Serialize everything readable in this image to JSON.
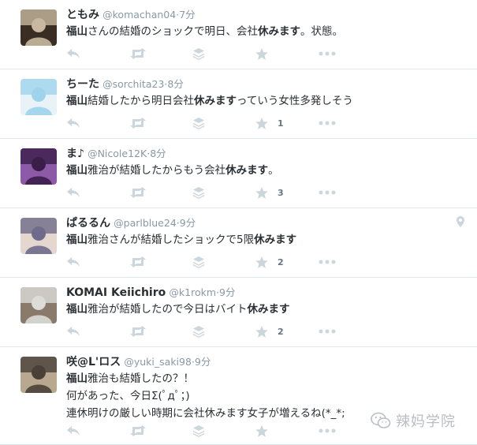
{
  "tweets": [
    {
      "name": "ともみ",
      "handle": "@komachan04",
      "dot": "·",
      "time": "7分",
      "lines": [
        [
          "福山",
          "さんの結婚のショックで明日、会社",
          "休みます",
          "。状態。"
        ]
      ],
      "favorites": "",
      "avatar_colors": [
        "#c9b9a0",
        "#3a2e24"
      ]
    },
    {
      "name": "ちーた",
      "handle": "@sorchita23",
      "dot": "·",
      "time": "8分",
      "lines": [
        [
          "福山",
          "結婚したから明日会社",
          "休みます",
          "っていう女性多発しそう"
        ]
      ],
      "favorites": "1",
      "avatar_colors": [
        "#9fd3ec",
        "#e9f3f7"
      ]
    },
    {
      "name": "ま♪",
      "handle": "@Nicole12K",
      "dot": "·",
      "time": "8分",
      "lines": [
        [
          "福山",
          "雅治が結婚したからもう会社",
          "休みます",
          "。"
        ]
      ],
      "favorites": "3",
      "avatar_colors": [
        "#3b1d4a",
        "#8c5aa6"
      ]
    },
    {
      "name": "ぱるるん",
      "handle": "@parlblue24",
      "dot": "·",
      "time": "9分",
      "lines": [
        [
          "福山",
          "雅治さんが結婚したショックで5限",
          "休みます",
          ""
        ]
      ],
      "favorites": "2",
      "avatar_colors": [
        "#6f6b8a",
        "#e3d7cf"
      ],
      "location": true
    },
    {
      "name": "KOMAI Keiichiro",
      "handle": "@k1rokm",
      "dot": "·",
      "time": "9分",
      "lines": [
        [
          "福山",
          "雅治が結婚したので今日はバイト",
          "休みます",
          ""
        ]
      ],
      "favorites": "2",
      "avatar_colors": [
        "#dcdcd8",
        "#8a7a6c"
      ]
    },
    {
      "name": "咲@L'ロス",
      "handle": "@yuki_saki98",
      "dot": "·",
      "time": "9分",
      "lines": [
        [
          "福山",
          "雅治も結婚したの？！",
          "",
          ""
        ],
        [
          "",
          "何があった、今日Σ(ﾟдﾟ；)",
          "",
          ""
        ],
        [
          "",
          "連休明けの厳しい時期に会社休みます女子が増えるね(*_*;",
          "",
          ""
        ]
      ],
      "favorites": "",
      "avatar_colors": [
        "#4a4038",
        "#b8a890"
      ]
    }
  ],
  "watermark": "辣妈学院",
  "icons": {
    "reply": "reply-icon",
    "retweet": "retweet-icon",
    "stack": "stack-icon",
    "favorite": "star-icon",
    "more": "more-icon",
    "location": "location-pin-icon",
    "watermark": "wechat-icon"
  },
  "colors": {
    "icon": "#ccd6dd",
    "handle": "#8899a6",
    "divider": "#e1e8ed"
  }
}
